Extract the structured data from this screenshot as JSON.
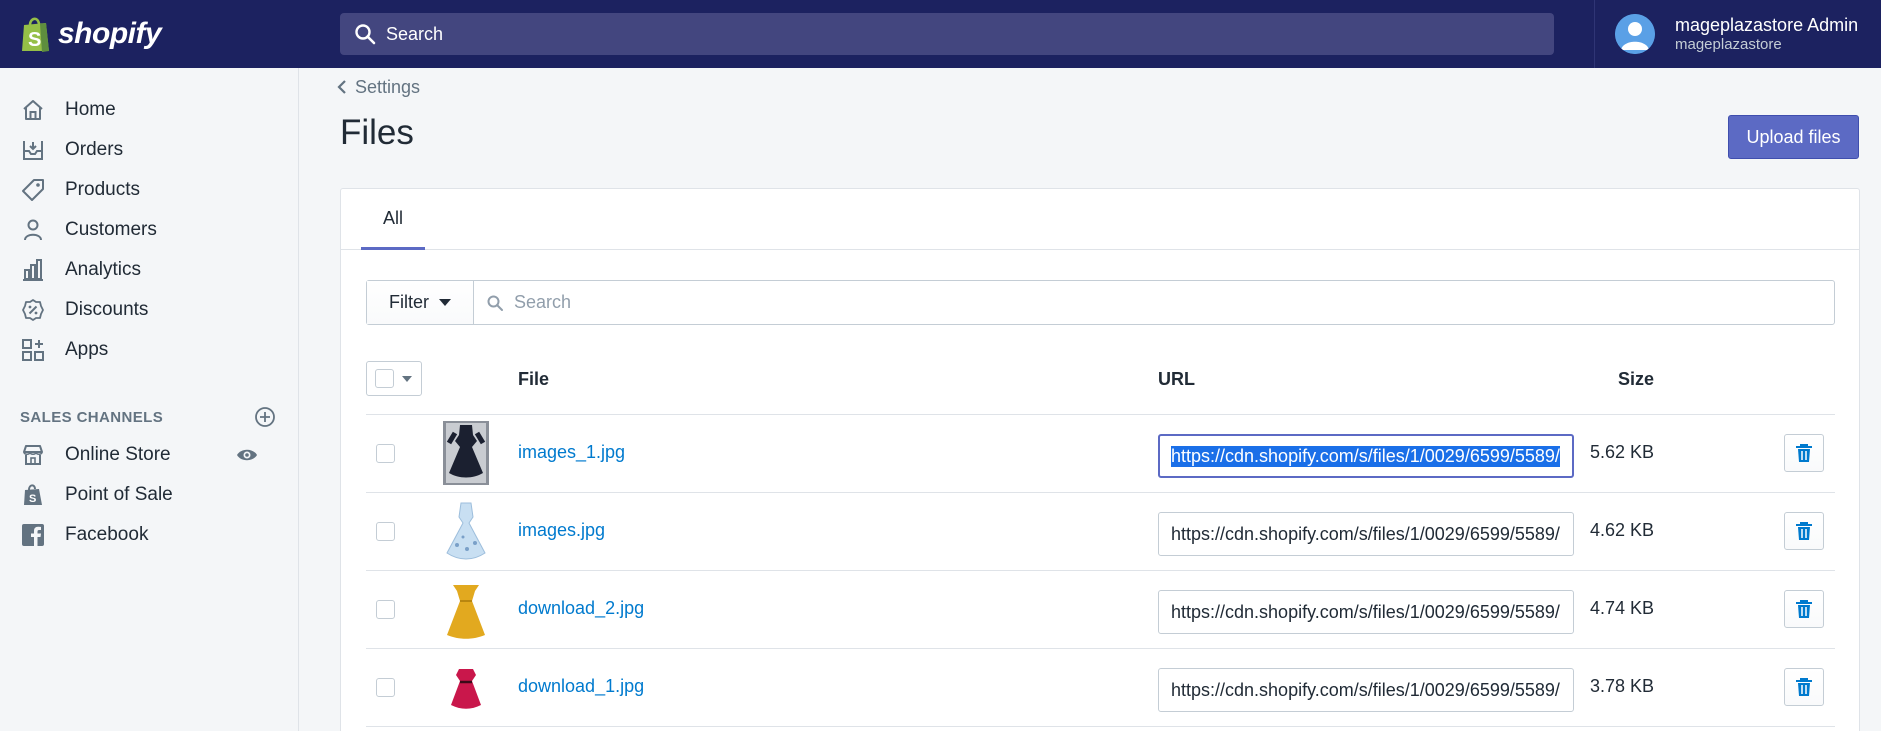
{
  "topbar": {
    "brand": "shopify",
    "search_placeholder": "Search",
    "user_name": "mageplazastore Admin",
    "user_store": "mageplazastore"
  },
  "sidebar": {
    "items": [
      {
        "label": "Home",
        "icon": "home-icon"
      },
      {
        "label": "Orders",
        "icon": "orders-icon"
      },
      {
        "label": "Products",
        "icon": "tag-icon"
      },
      {
        "label": "Customers",
        "icon": "person-icon"
      },
      {
        "label": "Analytics",
        "icon": "bar-chart-icon"
      },
      {
        "label": "Discounts",
        "icon": "discount-icon"
      },
      {
        "label": "Apps",
        "icon": "apps-icon"
      }
    ],
    "channels_heading": "SALES CHANNELS",
    "channels": [
      {
        "label": "Online Store",
        "icon": "store-icon"
      },
      {
        "label": "Point of Sale",
        "icon": "bag-icon"
      },
      {
        "label": "Facebook",
        "icon": "facebook-icon"
      }
    ]
  },
  "main": {
    "breadcrumb": "Settings",
    "title": "Files",
    "upload_label": "Upload files",
    "tab_all": "All",
    "filter_label": "Filter",
    "search_placeholder": "Search",
    "columns": {
      "file": "File",
      "url": "URL",
      "size": "Size"
    },
    "files": [
      {
        "name": "images_1.jpg",
        "url": "https://cdn.shopify.com/s/files/1/0029/6599/5589/",
        "size": "5.62 KB",
        "focused": true,
        "thumb": "black-dress"
      },
      {
        "name": "images.jpg",
        "url": "https://cdn.shopify.com/s/files/1/0029/6599/5589/",
        "size": "4.62 KB",
        "focused": false,
        "thumb": "white-floral-dress"
      },
      {
        "name": "download_2.jpg",
        "url": "https://cdn.shopify.com/s/files/1/0029/6599/5589/",
        "size": "4.74 KB",
        "focused": false,
        "thumb": "yellow-dress"
      },
      {
        "name": "download_1.jpg",
        "url": "https://cdn.shopify.com/s/files/1/0029/6599/5589/",
        "size": "3.78 KB",
        "focused": false,
        "thumb": "red-dress"
      }
    ]
  },
  "colors": {
    "topbar": "#1c2260",
    "accent": "#5c6ac4",
    "link": "#007ace",
    "brand_green": "#95bf47"
  }
}
